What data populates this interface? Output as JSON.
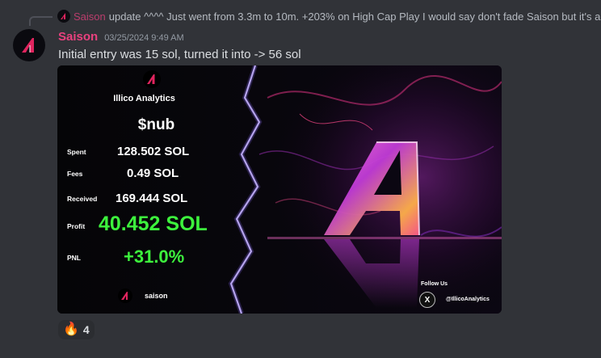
{
  "reply": {
    "username": "Saison",
    "text": "update ^^^^ Just went from 3.3m to 10m. +203% on High Cap Play I would say don't fade Saison but it's also"
  },
  "message": {
    "username": "Saison",
    "timestamp": "03/25/2024 9:49 AM",
    "text": "Initial entry was 15 sol, turned it into -> 56 sol"
  },
  "card": {
    "brand": "Illico Analytics",
    "ticker": "$nub",
    "rows": [
      {
        "label": "Spent",
        "value": "128.502 SOL"
      },
      {
        "label": "Fees",
        "value": "0.49 SOL"
      },
      {
        "label": "Received",
        "value": "169.444 SOL"
      },
      {
        "label": "Profit",
        "value": "40.452 SOL"
      },
      {
        "label": "PNL",
        "value": "+31.0%"
      }
    ],
    "footer_name": "saison",
    "follow_label": "Follow Us",
    "x_glyph": "X",
    "handle": "@IllicoAnalytics"
  },
  "reaction": {
    "emoji": "🔥",
    "count": "4"
  },
  "colors": {
    "background": "#313338",
    "username": "#e8417e",
    "profit_green": "#3df23d",
    "logo_red": "#e0245e"
  },
  "icons": [
    "reply-avatar-icon",
    "avatar-logo-icon",
    "illico-logo-icon",
    "x-logo-icon",
    "fire-emoji-icon"
  ]
}
